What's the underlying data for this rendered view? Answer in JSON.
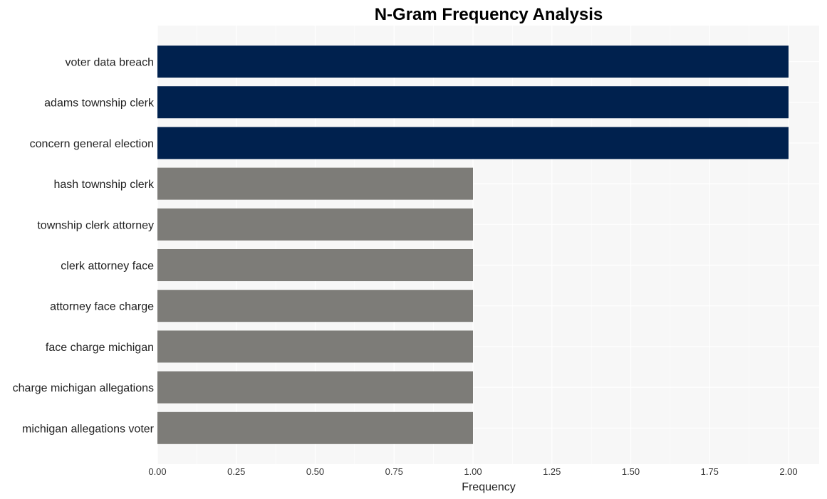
{
  "chart_data": {
    "type": "bar",
    "orientation": "horizontal",
    "title": "N-Gram Frequency Analysis",
    "xlabel": "Frequency",
    "ylabel": "",
    "xlim": [
      0,
      2.1
    ],
    "xticks": [
      "0.00",
      "0.25",
      "0.50",
      "0.75",
      "1.00",
      "1.25",
      "1.50",
      "1.75",
      "2.00"
    ],
    "xtick_values": [
      0,
      0.25,
      0.5,
      0.75,
      1.0,
      1.25,
      1.5,
      1.75,
      2.0
    ],
    "grid": true,
    "categories": [
      "voter data breach",
      "adams township clerk",
      "concern general election",
      "hash township clerk",
      "township clerk attorney",
      "clerk attorney face",
      "attorney face charge",
      "face charge michigan",
      "charge michigan allegations",
      "michigan allegations voter"
    ],
    "values": [
      2,
      2,
      2,
      1,
      1,
      1,
      1,
      1,
      1,
      1
    ],
    "colors": {
      "high": "#00214e",
      "low": "#7d7c78",
      "plot_background": "#f7f7f7",
      "grid": "#ffffff"
    }
  }
}
